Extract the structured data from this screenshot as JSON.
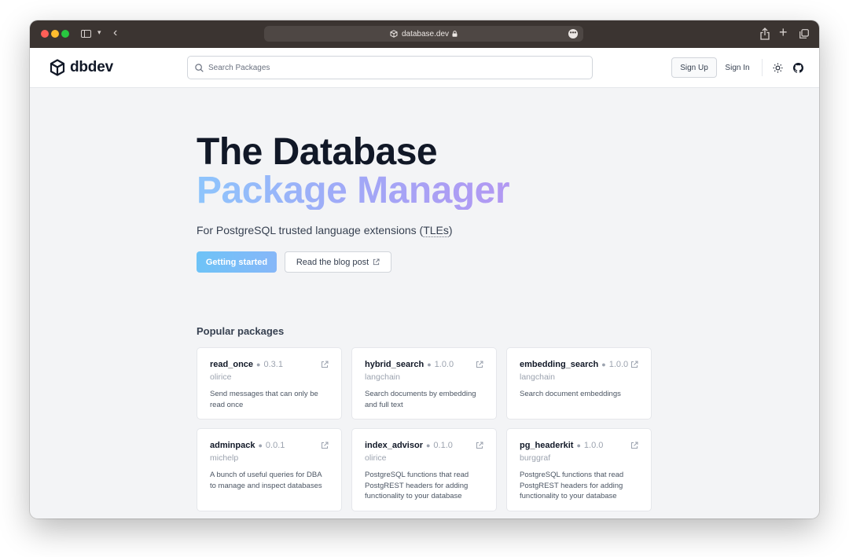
{
  "browser": {
    "url": "database.dev",
    "more_symbol": "•••"
  },
  "header": {
    "logo_text": "dbdev",
    "search_placeholder": "Search Packages",
    "signup_label": "Sign Up",
    "signin_label": "Sign In"
  },
  "hero": {
    "title_line1": "The Database",
    "title_line2": "Package Manager",
    "subtitle_prefix": "For PostgreSQL trusted language extensions (",
    "subtitle_abbr": "TLEs",
    "subtitle_suffix": ")",
    "primary_button": "Getting started",
    "secondary_button": "Read the blog post"
  },
  "popular": {
    "title": "Popular packages",
    "packages": [
      {
        "name": "read_once",
        "version": "0.3.1",
        "author": "olirice",
        "description": "Send messages that can only be read once"
      },
      {
        "name": "hybrid_search",
        "version": "1.0.0",
        "author": "langchain",
        "description": "Search documents by embedding and full text"
      },
      {
        "name": "embedding_search",
        "version": "1.0.0",
        "author": "langchain",
        "description": "Search document embeddings"
      },
      {
        "name": "adminpack",
        "version": "0.0.1",
        "author": "michelp",
        "description": "A bunch of useful queries for DBA to manage and inspect databases"
      },
      {
        "name": "index_advisor",
        "version": "0.1.0",
        "author": "olirice",
        "description": "PostgreSQL functions that read PostgREST headers for adding functionality to your database"
      },
      {
        "name": "pg_headerkit",
        "version": "1.0.0",
        "author": "burggraf",
        "description": "PostgreSQL functions that read PostgREST headers for adding functionality to your database"
      }
    ]
  },
  "colors": {
    "chrome": "#3b3431",
    "accent_gradient_start": "#8ec5fc",
    "accent_gradient_end": "#b298f2",
    "primary_button": "#6ec3f7"
  },
  "icons": [
    "sidebar-icon",
    "chevron-down-icon",
    "back-icon",
    "shield-icon",
    "lock-icon",
    "more-icon",
    "share-icon",
    "plus-icon",
    "tabs-icon",
    "logo-icon",
    "search-icon",
    "sun-icon",
    "github-icon",
    "external-link-icon"
  ]
}
